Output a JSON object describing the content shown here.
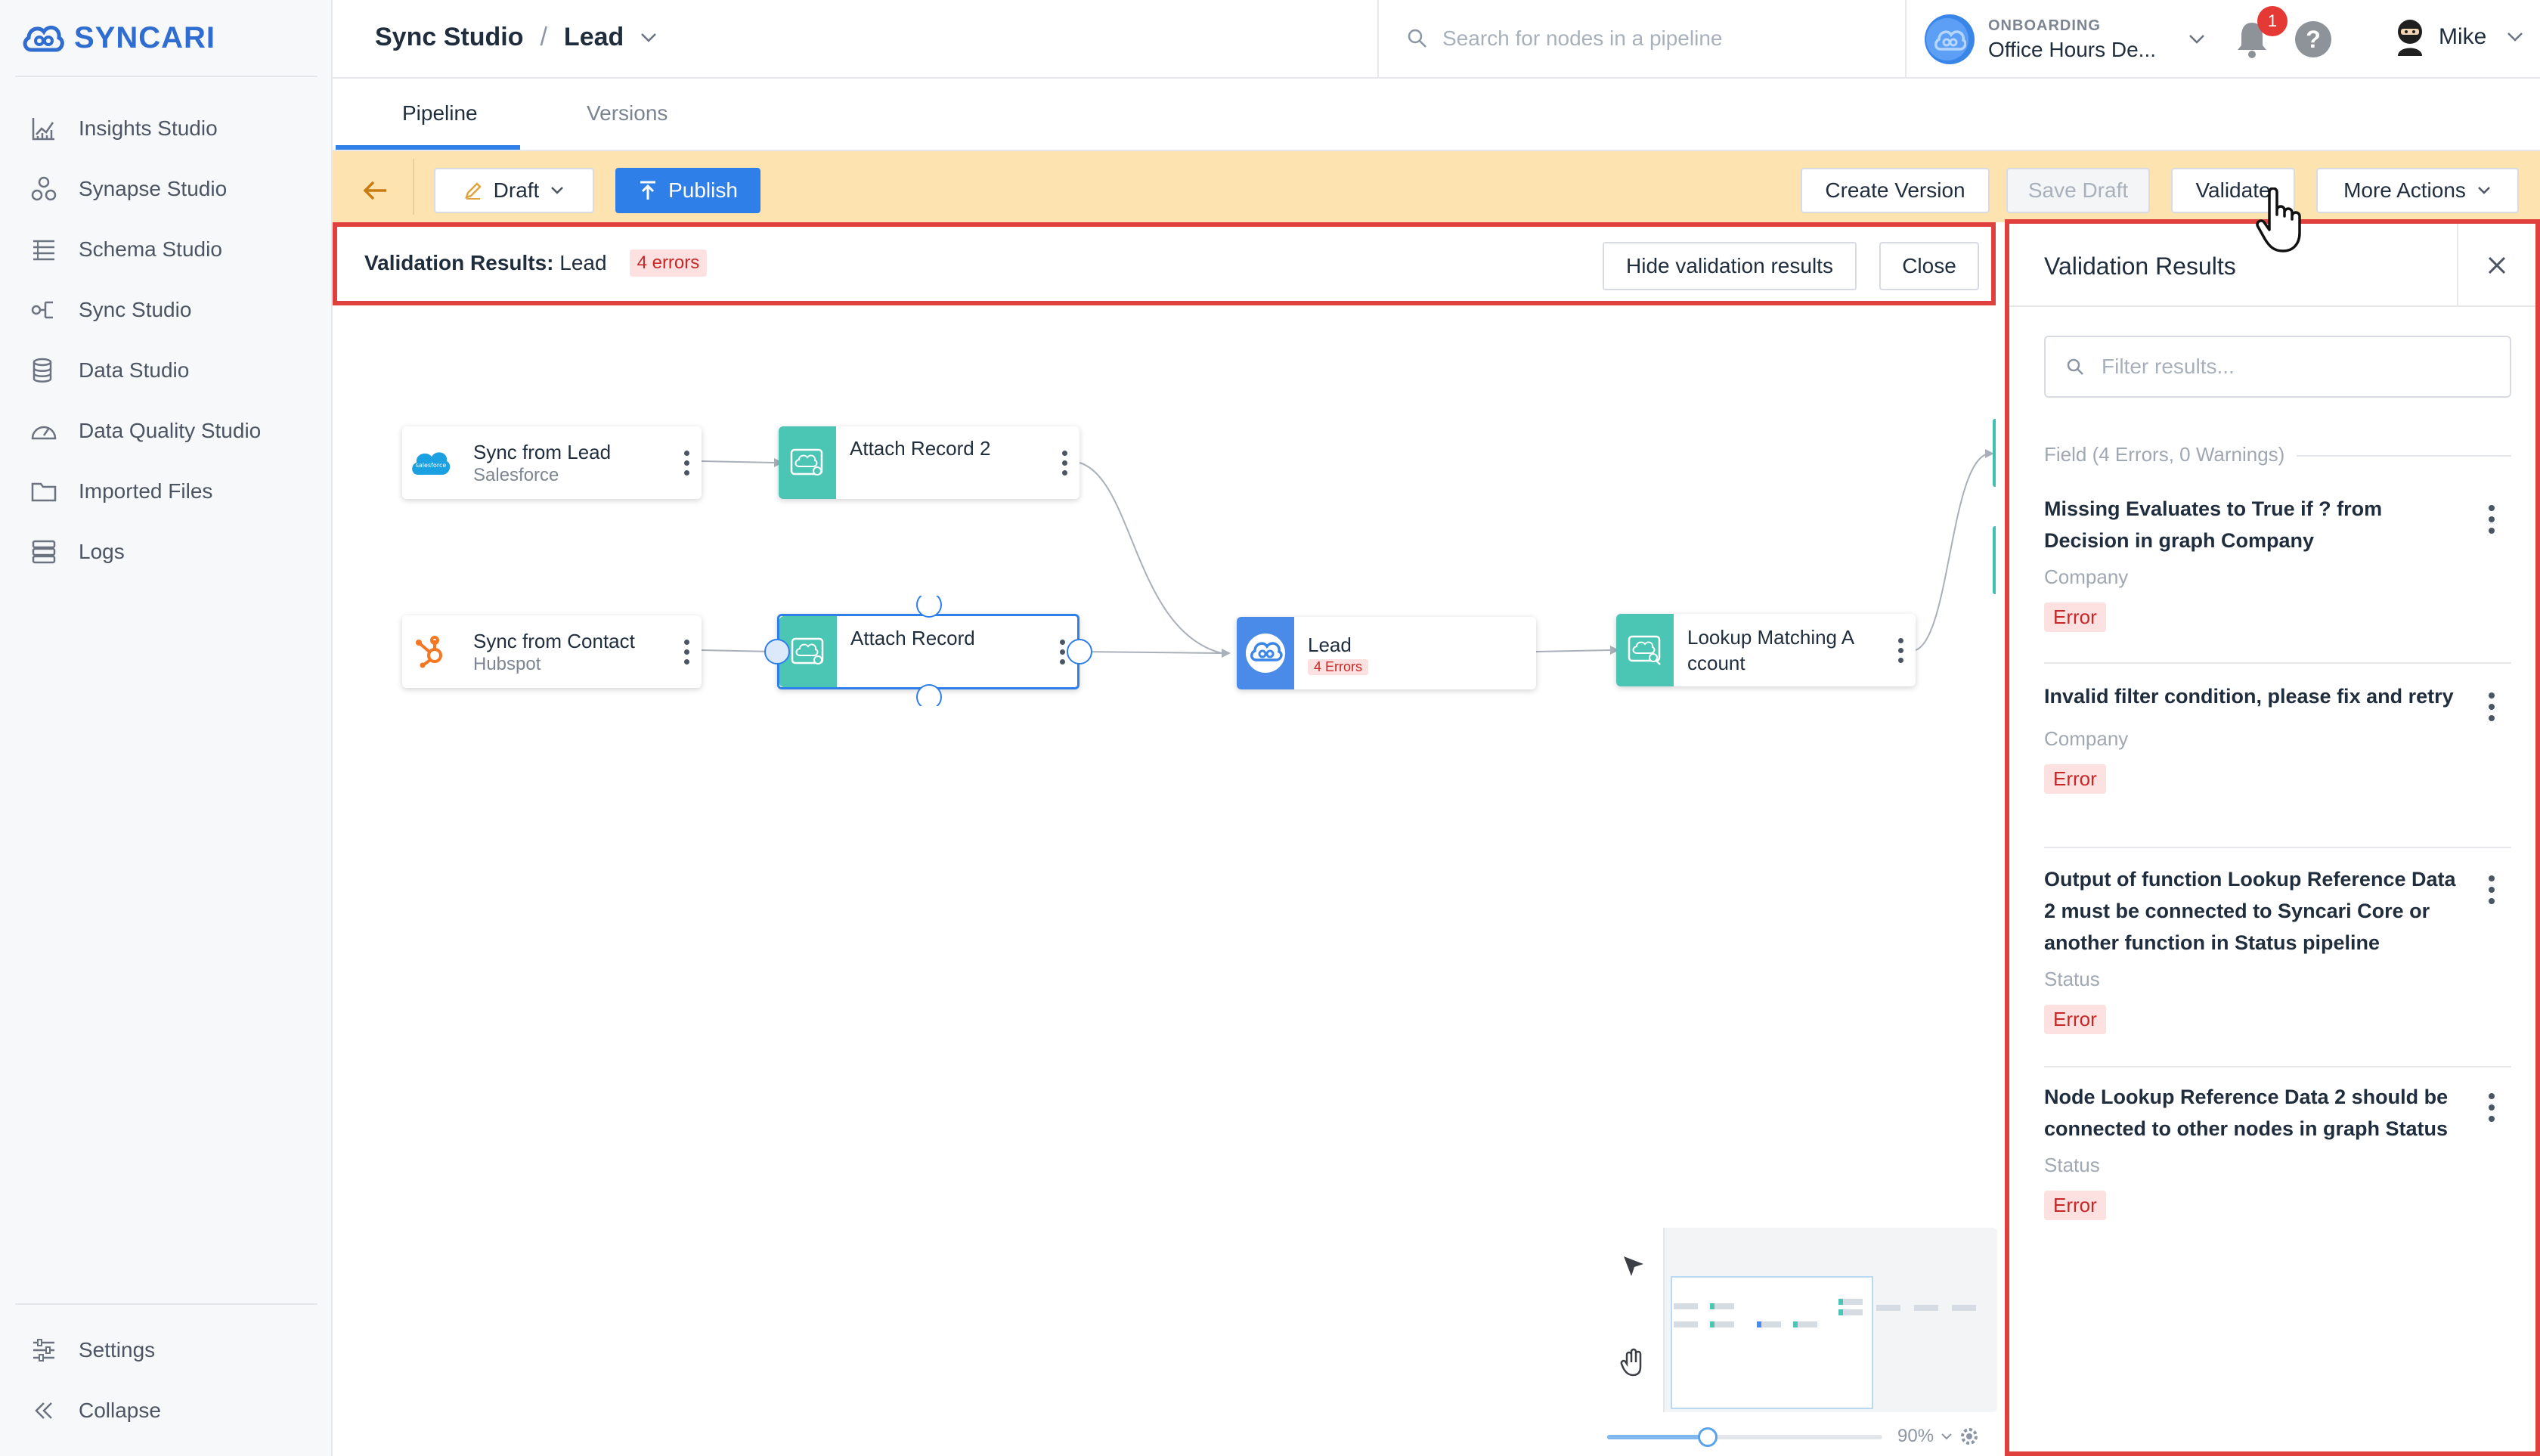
{
  "app": {
    "brand": "SYNCARI",
    "brand_color": "#2f6dd0"
  },
  "sidebar": {
    "items": [
      {
        "label": "Insights Studio",
        "icon": "chart-icon"
      },
      {
        "label": "Synapse Studio",
        "icon": "synapse-icon"
      },
      {
        "label": "Schema Studio",
        "icon": "schema-icon"
      },
      {
        "label": "Sync Studio",
        "icon": "sync-icon"
      },
      {
        "label": "Data Studio",
        "icon": "database-icon"
      },
      {
        "label": "Data Quality Studio",
        "icon": "gauge-icon"
      },
      {
        "label": "Imported Files",
        "icon": "folder-icon"
      },
      {
        "label": "Logs",
        "icon": "logs-icon"
      }
    ],
    "settings_label": "Settings",
    "collapse_label": "Collapse"
  },
  "header": {
    "breadcrumb_root": "Sync Studio",
    "breadcrumb_current": "Lead",
    "search_placeholder": "Search for nodes in a pipeline",
    "workspace_label": "ONBOARDING",
    "workspace_name": "Office Hours De...",
    "notification_count": "1",
    "help_label": "?",
    "user_name": "Mike"
  },
  "tabs": [
    {
      "label": "Pipeline",
      "active": true
    },
    {
      "label": "Versions",
      "active": false
    }
  ],
  "toolbar": {
    "draft_label": "Draft",
    "publish_label": "Publish",
    "create_version_label": "Create Version",
    "save_draft_label": "Save Draft",
    "validate_label": "Validate",
    "more_actions_label": "More Actions",
    "bg_color": "#fde3b0"
  },
  "validation_bar": {
    "title_bold": "Validation Results:",
    "title_entity": "Lead",
    "error_count": "4 errors",
    "hide_label": "Hide validation results",
    "close_label": "Close"
  },
  "nodes": {
    "sync_lead": {
      "title": "Sync from Lead",
      "subtitle": "Salesforce"
    },
    "attach2": {
      "title": "Attach Record 2"
    },
    "sync_contact": {
      "title": "Sync from Contact",
      "subtitle": "Hubspot"
    },
    "attach": {
      "title": "Attach Record"
    },
    "lead": {
      "title": "Lead",
      "errors": "4 Errors"
    },
    "lookup": {
      "title": "Lookup Matching A ccount"
    }
  },
  "minimap": {
    "zoom": "90%"
  },
  "results_panel": {
    "title": "Validation Results",
    "filter_placeholder": "Filter results...",
    "group_label": "Field (4 Errors, 0 Warnings)",
    "results": [
      {
        "message": "Missing Evaluates to True if ? from Decision in graph Company",
        "graph": "Company",
        "severity": "Error"
      },
      {
        "message": "Invalid filter condition, please fix and retry",
        "graph": "Company",
        "severity": "Error"
      },
      {
        "message": "Output of function Lookup Reference Data 2 must be connected to Syncari Core or another function in Status pipeline",
        "graph": "Status",
        "severity": "Error"
      },
      {
        "message": "Node Lookup Reference Data 2 should be connected to other nodes in graph Status",
        "graph": "Status",
        "severity": "Error"
      }
    ]
  }
}
